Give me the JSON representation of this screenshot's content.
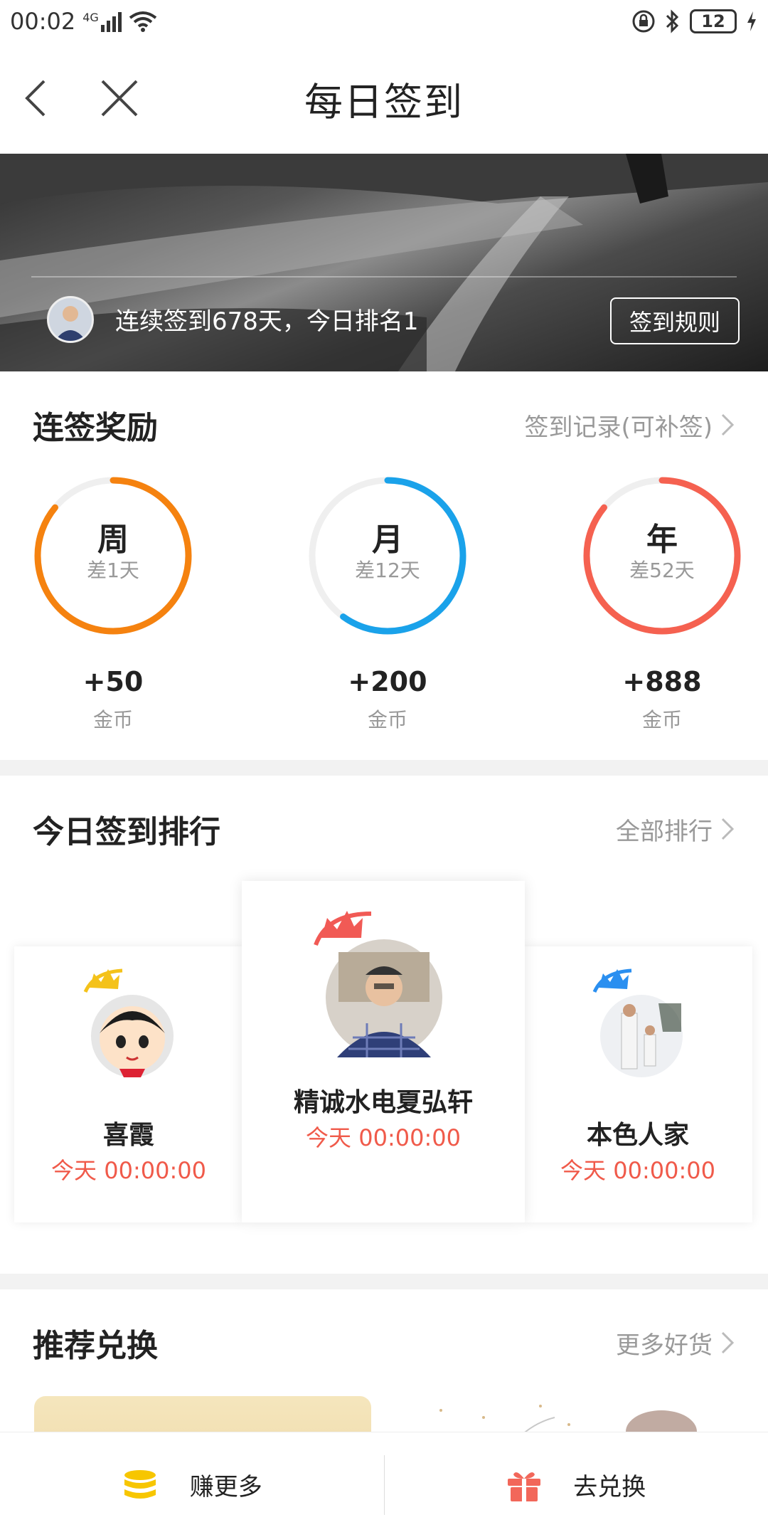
{
  "status_bar": {
    "time": "00:02",
    "network": "4G",
    "battery": "12"
  },
  "header": {
    "title": "每日签到"
  },
  "banner": {
    "streak_text": "连续签到678天，今日排名1",
    "rules_label": "签到规则"
  },
  "rewards": {
    "title": "连签奖励",
    "link_label": "签到记录(可补签)",
    "items": [
      {
        "period": "周",
        "remain": "差1天",
        "amount": "+50",
        "unit": "金币",
        "progress": 0.86,
        "color": "#f5820f"
      },
      {
        "period": "月",
        "remain": "差12天",
        "amount": "+200",
        "unit": "金币",
        "progress": 0.6,
        "color": "#1aa2ea"
      },
      {
        "period": "年",
        "remain": "差52天",
        "amount": "+888",
        "unit": "金币",
        "progress": 0.86,
        "color": "#f56150"
      }
    ]
  },
  "ranking": {
    "title": "今日签到排行",
    "link_label": "全部排行",
    "items": [
      {
        "name": "喜霞",
        "time": "今天 00:00:00",
        "crown_color": "#f4c21a"
      },
      {
        "name": "精诚水电夏弘轩",
        "time": "今天 00:00:00",
        "crown_color": "#f15a55"
      },
      {
        "name": "本色人家",
        "time": "今天 00:00:00",
        "crown_color": "#2a8ff0"
      }
    ]
  },
  "exchange": {
    "title": "推荐兑换",
    "link_label": "更多好货"
  },
  "bottom_bar": {
    "earn_label": "赚更多",
    "redeem_label": "去兑换"
  }
}
